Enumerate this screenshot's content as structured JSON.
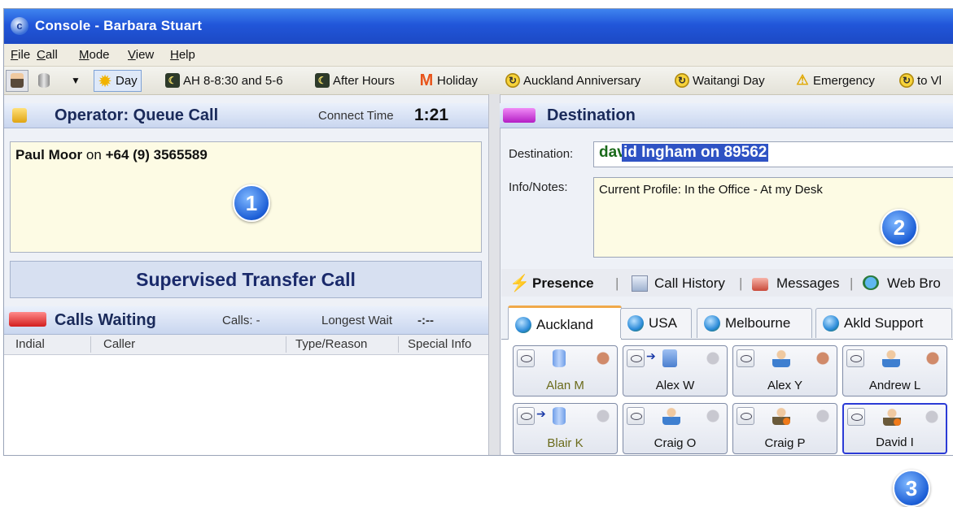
{
  "window": {
    "title": "Console - Barbara Stuart"
  },
  "menu": [
    "File",
    "Call",
    "Mode",
    "View",
    "Help"
  ],
  "toolbar": {
    "modes": [
      "Day",
      "AH 8-8:30 and 5-6",
      "After Hours",
      "Holiday",
      "Auckland Anniversary",
      "Waitangi Day",
      "Emergency",
      "to Vl"
    ]
  },
  "operator": {
    "title": "Operator: Queue Call",
    "connect_label": "Connect Time",
    "connect_time": "1:21",
    "caller_name": "Paul Moor",
    "caller_on": "on",
    "caller_number": "+64 (9) 3565589",
    "badge": "1",
    "transfer_button": "Supervised Transfer Call"
  },
  "calls_waiting": {
    "title": "Calls Waiting",
    "calls_label": "Calls: -",
    "longest_label": "Longest Wait",
    "longest_value": "-:--",
    "columns": [
      "Indial",
      "Caller",
      "Type/Reason",
      "Special Info"
    ]
  },
  "destination": {
    "title": "Destination",
    "dest_label": "Destination:",
    "dest_typed": "dav",
    "dest_selected": "id Ingham on 89562",
    "notes_label": "Info/Notes:",
    "notes_value": "Current Profile: In the Office - At my Desk",
    "badge": "2"
  },
  "panel_tabs": [
    "Presence",
    "Call History",
    "Messages",
    "Web Bro"
  ],
  "location_tabs": [
    "Auckland",
    "USA",
    "Melbourne",
    "Akld Support"
  ],
  "contacts": [
    {
      "name": "Alan M",
      "status": "away",
      "icon": "database-phone-icon"
    },
    {
      "name": "Alex W",
      "status": "forward",
      "icon": "building-icon"
    },
    {
      "name": "Alex Y",
      "status": "available",
      "icon": "user-icon"
    },
    {
      "name": "Andrew L",
      "status": "available",
      "icon": "user-icon"
    },
    {
      "name": "Blair K",
      "status": "away",
      "icon": "database-icon"
    },
    {
      "name": "Craig O",
      "status": "available",
      "icon": "user-icon"
    },
    {
      "name": "Craig P",
      "status": "busy",
      "icon": "user-star-icon"
    },
    {
      "name": "David I",
      "status": "busy",
      "icon": "user-star-icon"
    }
  ],
  "badge3": "3",
  "colors": {
    "title_bar": "#2156d9",
    "selection": "#2f53c4",
    "note_bg": "#fdfbe4",
    "tab_accent": "#f0a94a"
  }
}
